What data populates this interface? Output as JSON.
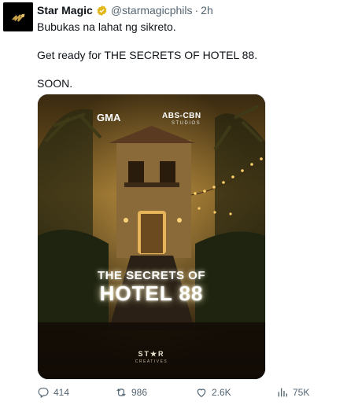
{
  "post": {
    "author_name": "Star Magic",
    "handle": "@starmagicphils",
    "separator": "·",
    "time": "2h",
    "lines": [
      "Bubukas na lahat ng sikreto.",
      "Get ready for THE SECRETS OF HOTEL 88.",
      "SOON."
    ]
  },
  "media": {
    "logo_left": "GMA",
    "logo_right": "ABS-CBN",
    "logo_right_sub": "STUDIOS",
    "title_small": "THE SECRETS OF",
    "title_large": "HOTEL 88",
    "brand": "ST★R",
    "brand_sub": "CREATIVES"
  },
  "actions": {
    "replies": "414",
    "reposts": "986",
    "likes": "2.6K",
    "views": "75K"
  },
  "colors": {
    "verified": "#e2b719",
    "muted": "#536471",
    "text": "#0f1419"
  },
  "icons": [
    "verified-badge-icon",
    "reply-icon",
    "repost-icon",
    "like-icon",
    "views-icon"
  ]
}
